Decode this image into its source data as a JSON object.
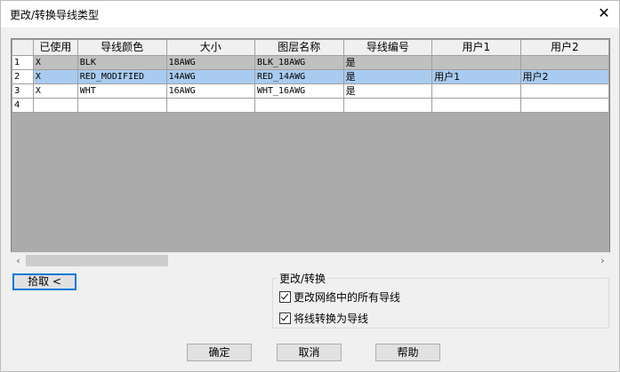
{
  "window": {
    "title": "更改/转换导线类型"
  },
  "grid": {
    "columns": [
      "",
      "已使用",
      "导线颜色",
      "大小",
      "图层名称",
      "导线编号",
      "用户1",
      "用户2"
    ],
    "rows": [
      {
        "num": "1",
        "used": "X",
        "color": "BLK",
        "size": "18AWG",
        "layer": "BLK_18AWG",
        "wirenum": "是",
        "user1": "",
        "user2": ""
      },
      {
        "num": "2",
        "used": "X",
        "color": "RED_MODIFIED",
        "size": "14AWG",
        "layer": "RED_14AWG",
        "wirenum": "是",
        "user1": "用户1",
        "user2": "用户2"
      },
      {
        "num": "3",
        "used": "X",
        "color": "WHT",
        "size": "16AWG",
        "layer": "WHT_16AWG",
        "wirenum": "是",
        "user1": "",
        "user2": ""
      },
      {
        "num": "4",
        "used": "",
        "color": "",
        "size": "",
        "layer": "",
        "wirenum": "",
        "user1": "",
        "user2": ""
      }
    ]
  },
  "scrollbar": {
    "left": "‹",
    "right": "›"
  },
  "pick_button": "拾取 <",
  "convert_group": {
    "label": "更改/转换",
    "options": [
      {
        "label": "更改网络中的所有导线",
        "checked": true
      },
      {
        "label": "将线转换为导线",
        "checked": true
      }
    ]
  },
  "buttons": {
    "ok": "确定",
    "cancel": "取消",
    "help": "帮助"
  },
  "colors": {
    "selected_row": "#a9cbef",
    "gray_row": "#c0c0c0",
    "grid_bg": "#ababab",
    "focus_border": "#0078d7"
  }
}
